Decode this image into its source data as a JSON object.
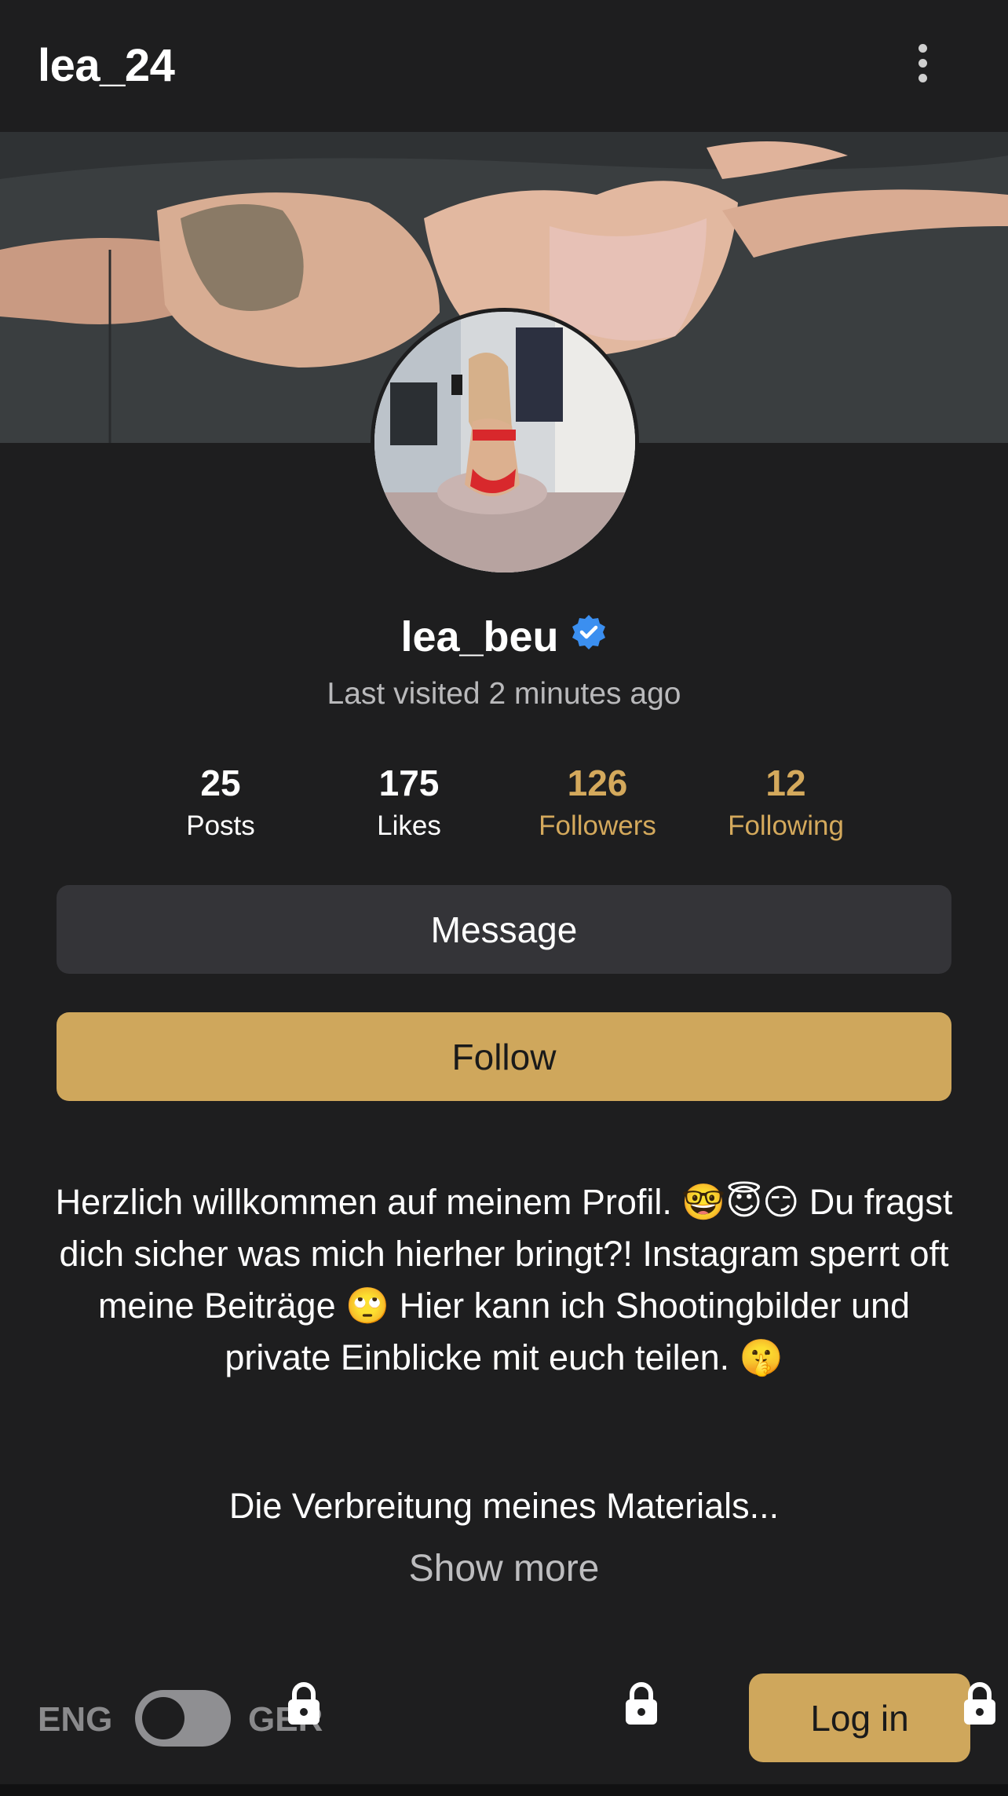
{
  "header": {
    "title": "lea_24",
    "menu_icon": "more-vertical-icon"
  },
  "profile": {
    "username": "lea_beu",
    "verified_icon": "verified-badge-icon",
    "last_visited": "Last visited 2 minutes ago",
    "stats": [
      {
        "value": "25",
        "label": "Posts"
      },
      {
        "value": "175",
        "label": "Likes"
      },
      {
        "value": "126",
        "label": "Followers"
      },
      {
        "value": "12",
        "label": "Following"
      }
    ]
  },
  "actions": {
    "message_label": "Message",
    "follow_label": "Follow"
  },
  "bio": {
    "text": "Herzlich willkommen auf meinem Profil. 🤓😇😏 Du fragst dich sicher was mich hierher bringt?! Instagram sperrt oft meine Beiträge 🙄 Hier kann ich Shootingbilder und private Einblicke mit euch teilen. 🤫",
    "truncated_text": "Die Verbreitung meines Materials...",
    "show_more_label": "Show more"
  },
  "footer": {
    "lang_left": "ENG",
    "lang_right": "GER",
    "login_label": "Log in",
    "lock_icon": "lock-icon"
  },
  "colors": {
    "background": "#1e1e1f",
    "accent_gold": "#cfa75c",
    "gold_text": "#d4a95c",
    "button_dark": "#343438",
    "verified_blue": "#3b8ff0"
  }
}
